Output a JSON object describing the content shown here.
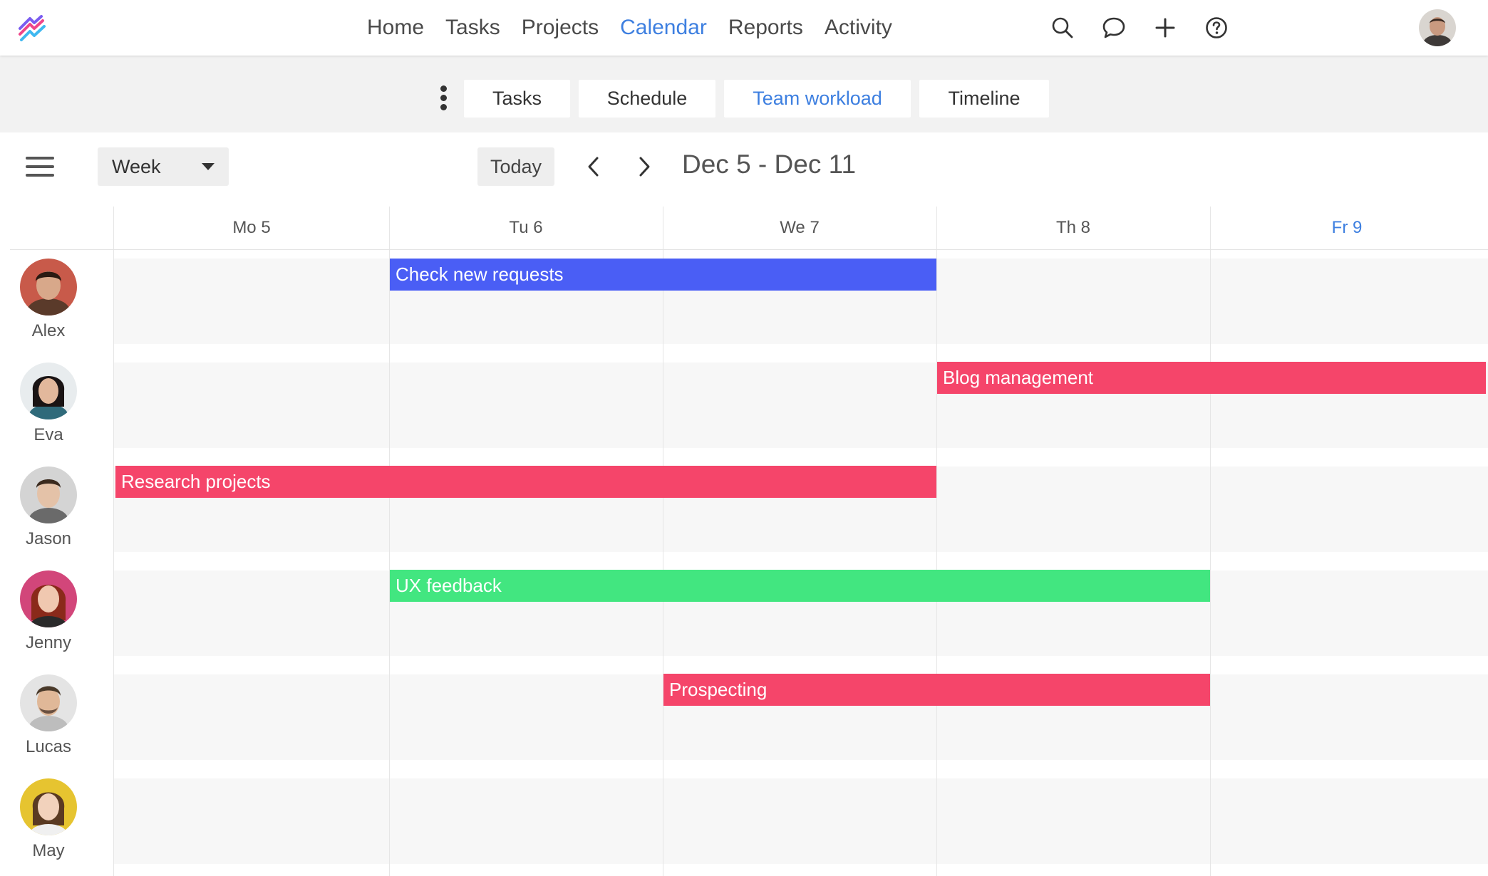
{
  "nav": {
    "items": [
      "Home",
      "Tasks",
      "Projects",
      "Calendar",
      "Reports",
      "Activity"
    ],
    "active": "Calendar",
    "icons": [
      "search-icon",
      "chat-bubble-icon",
      "plus-icon",
      "help-circle-icon"
    ]
  },
  "subtabs": {
    "items": [
      "Tasks",
      "Schedule",
      "Team workload",
      "Timeline"
    ],
    "active": "Team workload"
  },
  "toolbar": {
    "view_select": "Week",
    "today_label": "Today",
    "date_range": "Dec 5 - Dec 11"
  },
  "calendar": {
    "days": [
      "Mo 5",
      "Tu 6",
      "We 7",
      "Th 8",
      "Fr 9"
    ],
    "today": "Fr 9",
    "people": [
      "Alex",
      "Eva",
      "Jason",
      "Jenny",
      "Lucas",
      "May"
    ],
    "tasks": [
      {
        "title": "Check new requests",
        "person": "Alex",
        "start_day": "Tu 6",
        "end_day": "We 7",
        "color": "#4a5ef5"
      },
      {
        "title": "Blog management",
        "person": "Eva",
        "start_day": "Th 8",
        "end_day": "Fr 9",
        "color": "#f5456a"
      },
      {
        "title": "Research projects",
        "person": "Jason",
        "start_day": "Mo 5",
        "end_day": "We 7",
        "color": "#f5456a"
      },
      {
        "title": "UX feedback",
        "person": "Jenny",
        "start_day": "Tu 6",
        "end_day": "Th 8",
        "color": "#42e680"
      },
      {
        "title": "Prospecting",
        "person": "Lucas",
        "start_day": "We 7",
        "end_day": "Th 8",
        "color": "#f5456a"
      }
    ]
  },
  "colors": {
    "accent": "#3d7fe0",
    "red": "#f5456a",
    "blue": "#4a5ef5",
    "green": "#42e680"
  }
}
